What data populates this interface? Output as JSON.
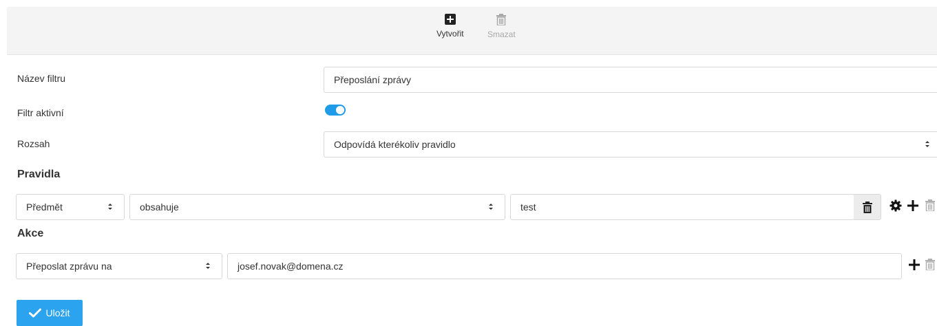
{
  "toolbar": {
    "create_label": "Vytvořit",
    "delete_label": "Smazat"
  },
  "form": {
    "filter_name_label": "Název filtru",
    "filter_name_value": "Přeposlání zprávy",
    "filter_active_label": "Filtr aktivní",
    "filter_active_on": true,
    "scope_label": "Rozsah",
    "scope_value": "Odpovídá kterékoliv pravidlo"
  },
  "rules": {
    "heading": "Pravidla",
    "items": [
      {
        "field": "Předmět",
        "operator": "obsahuje",
        "value": "test"
      }
    ]
  },
  "actions": {
    "heading": "Akce",
    "items": [
      {
        "action": "Přeposlat zprávu na",
        "target": "josef.novak@domena.cz"
      }
    ]
  },
  "save_label": "Uložit",
  "colors": {
    "accent": "#2ba3ee",
    "toggle": "#1f9be8",
    "toolbar_bg": "#f4f4f4"
  }
}
